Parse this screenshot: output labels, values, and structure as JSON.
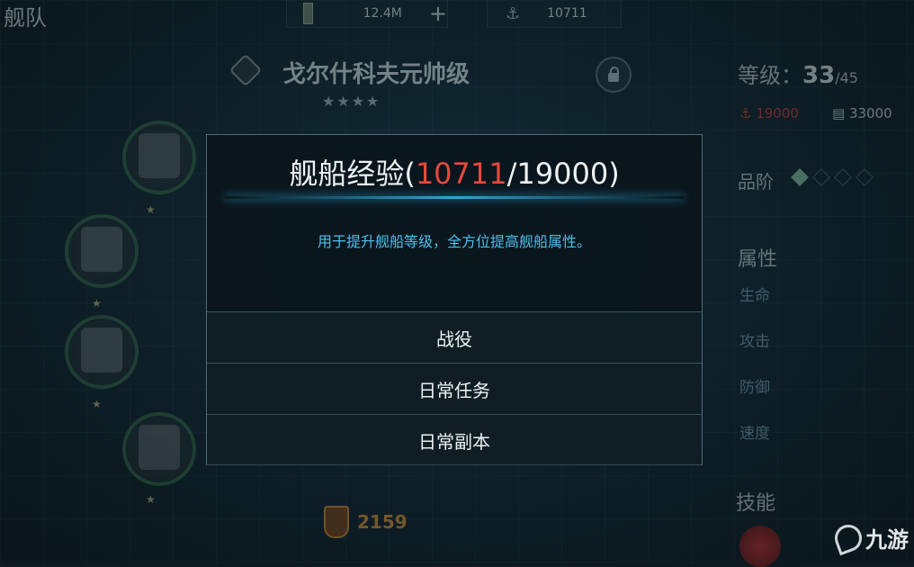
{
  "header": {
    "title": "舰队",
    "cash_value": "12.4M",
    "plus_symbol": "+",
    "anchor_value": "10711"
  },
  "ship": {
    "name": "戈尔什科夫元帅级",
    "stars": "★★★★"
  },
  "stats": {
    "level_label": "等级：",
    "level_current": "33",
    "level_max": "/45",
    "anchor_cost": "19000",
    "cash_cost": "33000",
    "rank_label": "品阶",
    "attributes_title": "属性",
    "attributes": [
      "生命",
      "攻击",
      "防御",
      "速度"
    ],
    "skills_title": "技能"
  },
  "badge_value": "2159",
  "watermark": "九游",
  "modal": {
    "title_prefix": "舰船经验(",
    "title_current": "10711",
    "title_suffix": "/19000)",
    "description": "用于提升舰船等级，全方位提高舰船属性。",
    "options": [
      "战役",
      "日常任务",
      "日常副本"
    ]
  },
  "colors": {
    "accent_blue": "#2ea6d6",
    "current_red": "#e8483d"
  }
}
